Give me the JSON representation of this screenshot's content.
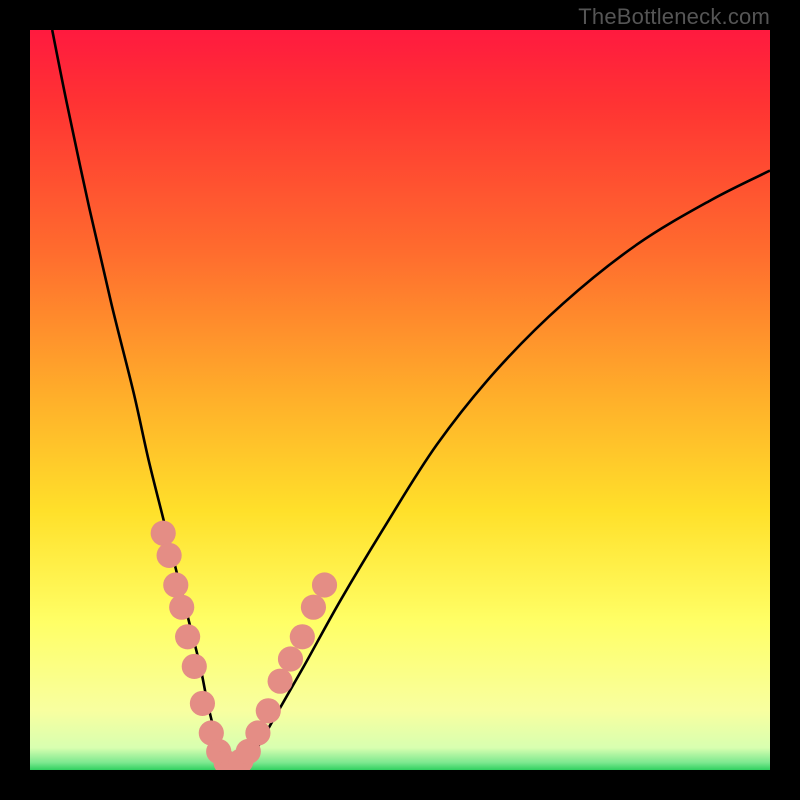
{
  "watermark": {
    "text": "TheBottleneck.com"
  },
  "gradient": {
    "stops": [
      {
        "offset": 0.0,
        "color": "#FF1A3F"
      },
      {
        "offset": 0.1,
        "color": "#FF3333"
      },
      {
        "offset": 0.3,
        "color": "#FF6C2E"
      },
      {
        "offset": 0.5,
        "color": "#FFB02A"
      },
      {
        "offset": 0.65,
        "color": "#FFE02A"
      },
      {
        "offset": 0.8,
        "color": "#FFFF66"
      },
      {
        "offset": 0.92,
        "color": "#F8FFA0"
      },
      {
        "offset": 0.965,
        "color": "#D8FFB0"
      },
      {
        "offset": 0.985,
        "color": "#7CE88F"
      },
      {
        "offset": 1.0,
        "color": "#30D060"
      }
    ]
  },
  "chart_data": {
    "type": "line",
    "title": "",
    "xlabel": "",
    "ylabel": "",
    "xlim": [
      0,
      100
    ],
    "ylim": [
      0,
      100
    ],
    "series": [
      {
        "name": "bottleneck-curve",
        "x": [
          3,
          5,
          8,
          11,
          14,
          16,
          18,
          20,
          21.5,
          23,
          24,
          25,
          26,
          27.5,
          30,
          33,
          37,
          42,
          48,
          55,
          63,
          72,
          82,
          92,
          100
        ],
        "values": [
          100,
          90,
          76,
          63,
          51,
          42,
          34,
          26,
          20,
          14,
          9,
          5,
          2,
          0.5,
          2,
          7,
          14,
          23,
          33,
          44,
          54,
          63,
          71,
          77,
          81
        ]
      }
    ],
    "markers": {
      "name": "beads",
      "points": [
        {
          "x": 18.0,
          "y": 32
        },
        {
          "x": 18.8,
          "y": 29
        },
        {
          "x": 19.7,
          "y": 25
        },
        {
          "x": 20.5,
          "y": 22
        },
        {
          "x": 21.3,
          "y": 18
        },
        {
          "x": 22.2,
          "y": 14
        },
        {
          "x": 23.3,
          "y": 9
        },
        {
          "x": 24.5,
          "y": 5
        },
        {
          "x": 25.5,
          "y": 2.5
        },
        {
          "x": 26.5,
          "y": 1.0
        },
        {
          "x": 27.5,
          "y": 0.6
        },
        {
          "x": 28.5,
          "y": 1.2
        },
        {
          "x": 29.5,
          "y": 2.5
        },
        {
          "x": 30.8,
          "y": 5
        },
        {
          "x": 32.2,
          "y": 8
        },
        {
          "x": 33.8,
          "y": 12
        },
        {
          "x": 35.2,
          "y": 15
        },
        {
          "x": 36.8,
          "y": 18
        },
        {
          "x": 38.3,
          "y": 22
        },
        {
          "x": 39.8,
          "y": 25
        }
      ],
      "radius_data_units": 1.7
    }
  }
}
